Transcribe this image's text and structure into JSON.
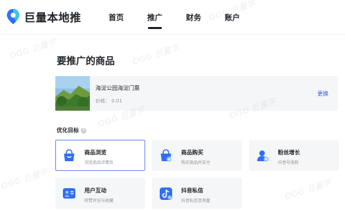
{
  "brand": {
    "name": "巨量本地推",
    "accent": "#2f5ff0",
    "logo_colors": [
      "#2f6ff6",
      "#39c6e8"
    ]
  },
  "nav": {
    "items": [
      {
        "label": "首页",
        "active": false
      },
      {
        "label": "推广",
        "active": true
      },
      {
        "label": "财务",
        "active": false
      },
      {
        "label": "账户",
        "active": false
      }
    ]
  },
  "page": {
    "title": "要推广的商品"
  },
  "product": {
    "name": "海淀公园海淀门票",
    "price": "价格： 0.01",
    "change_label": "更换",
    "thumbnail": "park-scene-image"
  },
  "goals": {
    "label": "优化目标",
    "help_icon": "question-circle-icon",
    "help_glyph": "?",
    "items": [
      {
        "title": "商品浏览",
        "subtitle": "浏览商品详情页",
        "icon": "shopping-bag-icon",
        "selected": true
      },
      {
        "title": "商品购买",
        "subtitle": "购买商品并支付",
        "icon": "shopping-bag-check-icon",
        "selected": false
      },
      {
        "title": "粉丝增长",
        "subtitle": "抖音号涨粉",
        "icon": "user-plus-icon",
        "selected": false
      },
      {
        "title": "用户互动",
        "subtitle": "转赞评论与收藏",
        "icon": "chat-bubbles-icon",
        "selected": false
      },
      {
        "title": "抖音私信",
        "subtitle": "抖音私信咨询量",
        "icon": "douyin-icon",
        "selected": false
      }
    ]
  },
  "watermark": {
    "text": "OGG 巨量学"
  }
}
